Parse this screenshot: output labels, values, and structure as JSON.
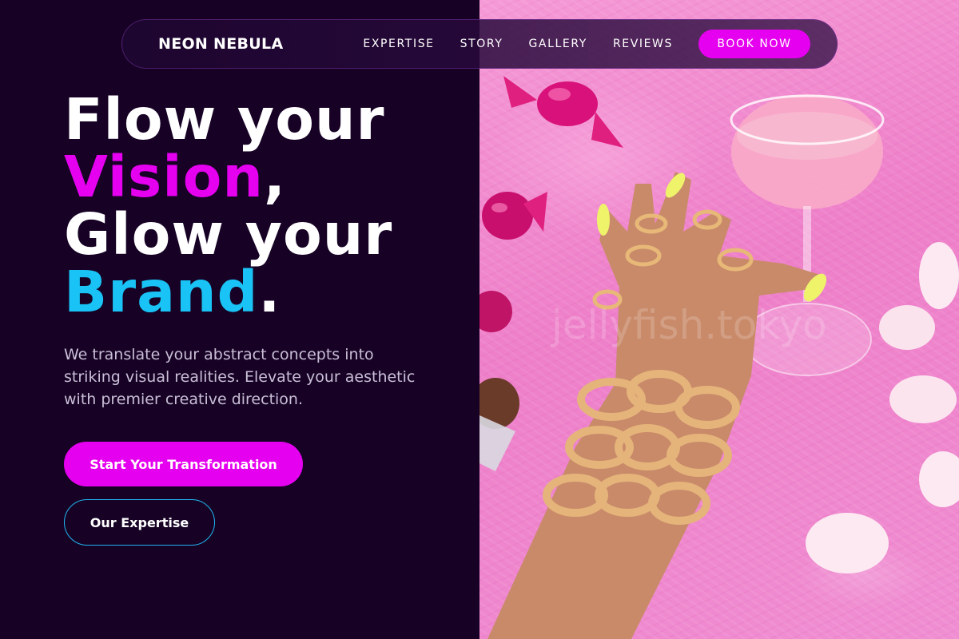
{
  "header": {
    "brand": "NEON NEBULA",
    "nav": [
      "EXPERTISE",
      "STORY",
      "GALLERY",
      "REVIEWS"
    ],
    "cta": "BOOK NOW"
  },
  "hero": {
    "line1": "Flow your",
    "line2_accent": "Vision",
    "line2_punct": ",",
    "line3": "Glow your",
    "line4_accent": "Brand",
    "line4_punct": ".",
    "description": "We translate your abstract concepts into striking visual realities. Elevate your aesthetic with premier creative direction.",
    "primary_button": "Start Your Transformation",
    "secondary_button": "Our Expertise"
  },
  "image": {
    "watermark": "jellyfish.tokyo",
    "alt_subject": "hand with gold chain bracelets and rings holding a pink cocktail glass on pink fur with candies and petals"
  },
  "colors": {
    "background": "#170226",
    "magenta": "#e600f0",
    "cyan": "#19c3f5",
    "fur_pink": "#f08ed2"
  }
}
